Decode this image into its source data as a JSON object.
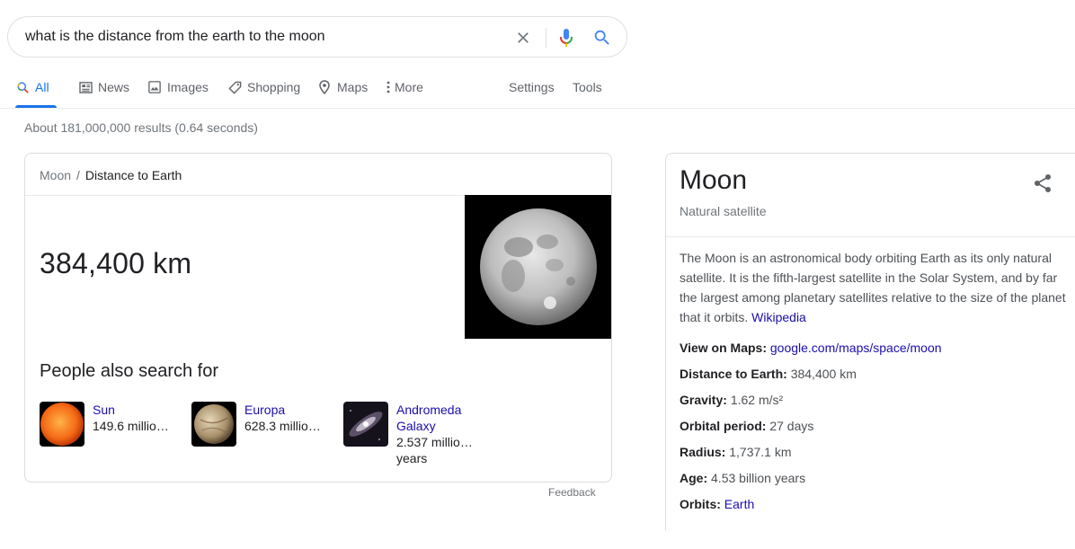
{
  "search": {
    "query": "what is the distance from the earth to the moon"
  },
  "tabs": [
    {
      "label": "All",
      "icon": "search-icon",
      "active": true
    },
    {
      "label": "News",
      "icon": "news-icon"
    },
    {
      "label": "Images",
      "icon": "image-icon"
    },
    {
      "label": "Shopping",
      "icon": "tag-icon"
    },
    {
      "label": "Maps",
      "icon": "map-pin-icon"
    },
    {
      "label": "More",
      "icon": "more-vert-icon"
    }
  ],
  "tools": {
    "settings": "Settings",
    "tools": "Tools"
  },
  "result_stats": "About 181,000,000 results (0.64 seconds)",
  "answer_card": {
    "breadcrumb_parent": "Moon",
    "breadcrumb_sep": "/",
    "breadcrumb_current": "Distance to Earth",
    "answer": "384,400 km",
    "people_also_search_title": "People also search for",
    "related": [
      {
        "name": "Sun",
        "value": "149.6 millio…"
      },
      {
        "name": "Europa",
        "value": "628.3 millio…"
      },
      {
        "name_line1": "Andromeda",
        "name_line2": "Galaxy",
        "value_line1": "2.537 millio…",
        "value_line2": "years"
      }
    ],
    "feedback": "Feedback"
  },
  "knowledge_panel": {
    "title": "Moon",
    "subtitle": "Natural satellite",
    "description": "The Moon is an astronomical body orbiting Earth as its only natural satellite. It is the fifth-largest satellite in the Solar System, and by far the largest among planetary satellites relative to the size of the planet that it orbits.",
    "source": "Wikipedia",
    "facts": [
      {
        "label": "View on Maps:",
        "value": "google.com/maps/space/moon",
        "link": true
      },
      {
        "label": "Distance to Earth:",
        "value": "384,400 km"
      },
      {
        "label": "Gravity:",
        "value": "1.62 m/s²"
      },
      {
        "label": "Orbital period:",
        "value": "27 days"
      },
      {
        "label": "Radius:",
        "value": "1,737.1 km"
      },
      {
        "label": "Age:",
        "value": "4.53 billion years"
      },
      {
        "label": "Orbits:",
        "value": "Earth",
        "link": true
      }
    ]
  },
  "colors": {
    "link": "#1a0dab",
    "active_tab": "#1a73e8",
    "secondary_text": "#70757a"
  }
}
